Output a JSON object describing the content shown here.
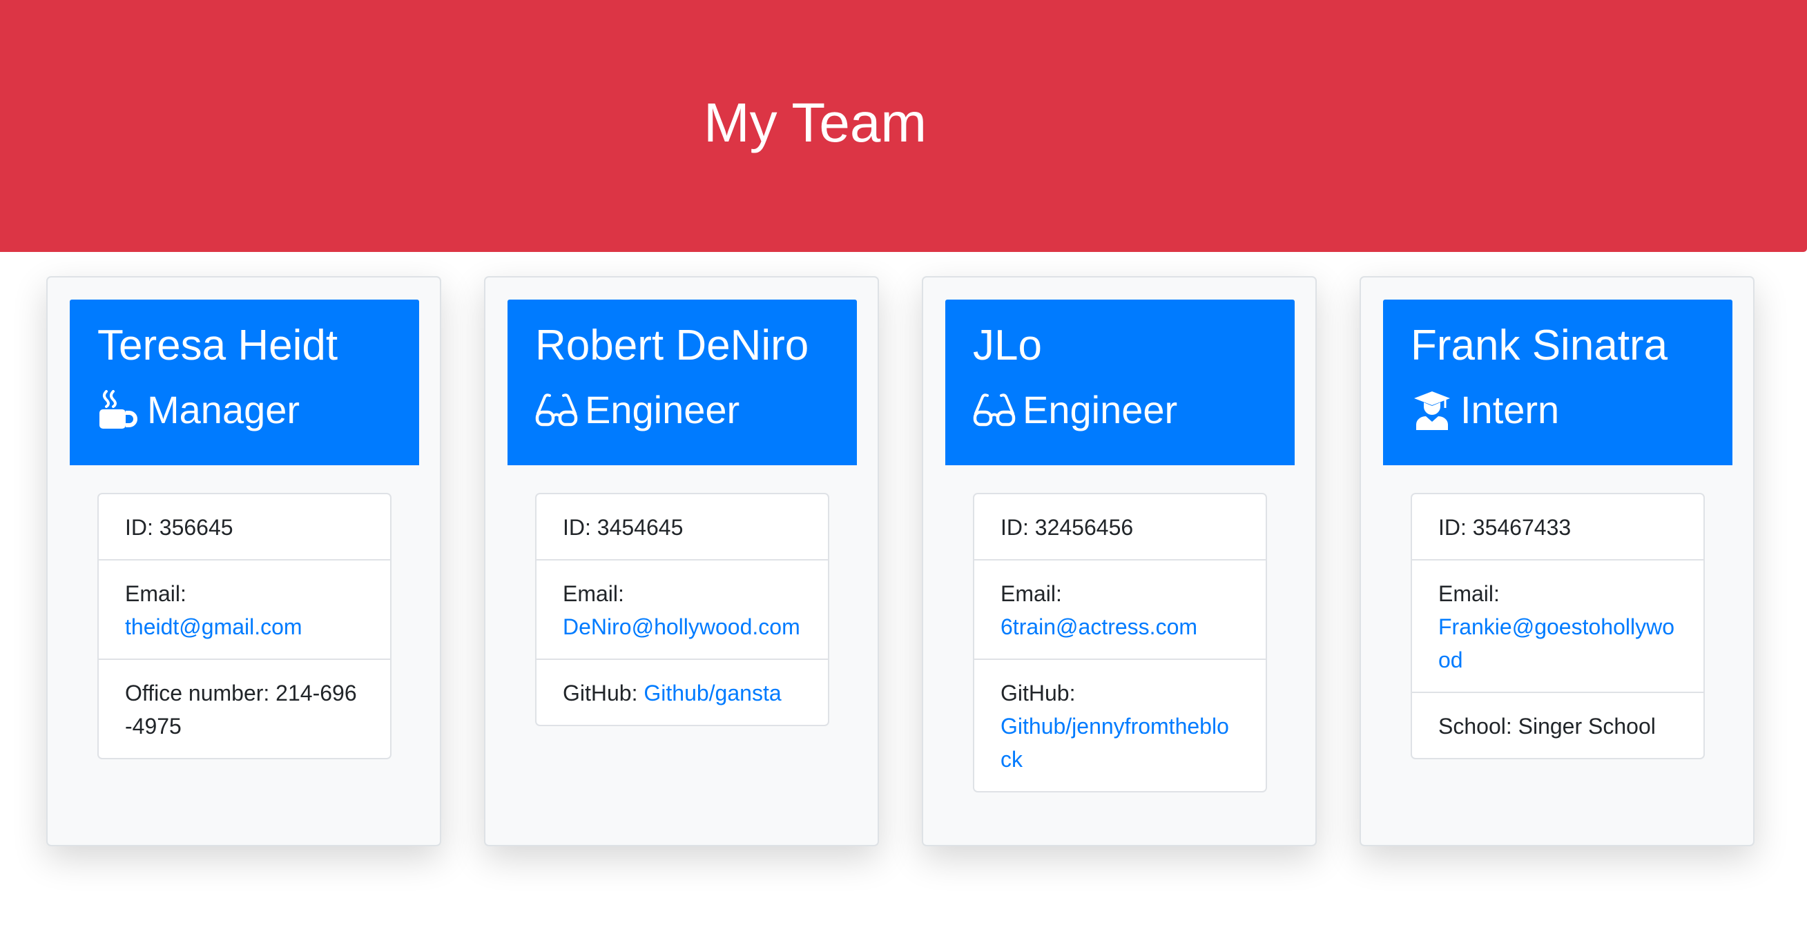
{
  "header": {
    "title": "My Team"
  },
  "cards": [
    {
      "name": "Teresa Heidt",
      "role": "Manager",
      "role_icon": "coffee-mug-icon",
      "id_label": "ID: 356645",
      "email_label": "Email:",
      "email": "theidt@gmail.com",
      "extra_label": "Office number: 214-696-4975",
      "extra_link": ""
    },
    {
      "name": "Robert DeNiro",
      "role": "Engineer",
      "role_icon": "glasses-icon",
      "id_label": "ID: 3454645",
      "email_label": "Email:",
      "email": "DeNiro@hollywood.com",
      "extra_label": "GitHub: ",
      "extra_link": "Github/gansta"
    },
    {
      "name": "JLo",
      "role": "Engineer",
      "role_icon": "glasses-icon",
      "id_label": "ID: 32456456",
      "email_label": "Email:",
      "email": "6train@actress.com",
      "extra_label": "GitHub: ",
      "extra_link": "Github/jennyfromtheblock"
    },
    {
      "name": "Frank Sinatra",
      "role": "Intern",
      "role_icon": "graduate-icon",
      "id_label": "ID: 35467433",
      "email_label": "Email:",
      "email": "Frankie@goestohollywood",
      "extra_label": "School: Singer School",
      "extra_link": ""
    }
  ],
  "colors": {
    "header_bg": "#dc3545",
    "card_header_bg": "#007bff",
    "link": "#007bff"
  }
}
